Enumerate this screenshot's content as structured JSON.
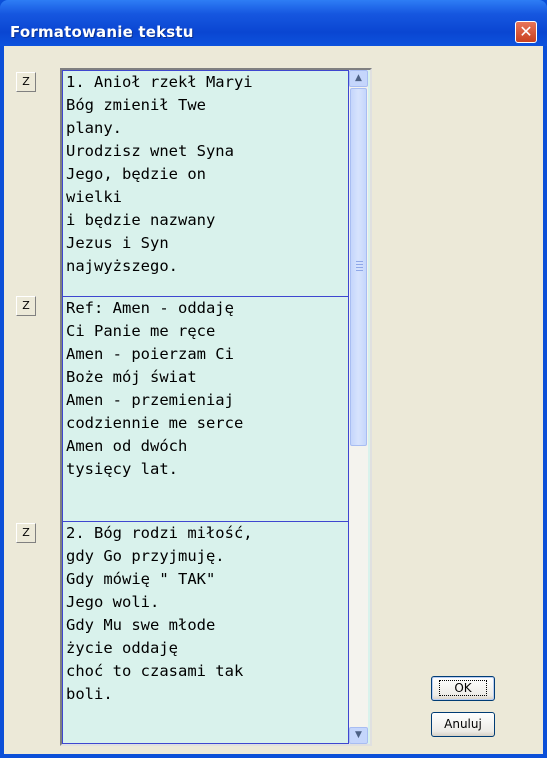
{
  "window": {
    "title": "Formatowanie tekstu",
    "close_glyph": "✕"
  },
  "items": [
    {
      "button_label": "Z",
      "text": "1. Anioł rzekł Maryi\nBóg zmienił Twe\nplany.\nUrodzisz wnet Syna\nJego, będzie on\nwielki\ni będzie nazwany\nJezus i Syn\nnajwyższego."
    },
    {
      "button_label": "Z",
      "text": "Ref: Amen - oddaję\nCi Panie me ręce\nAmen - poierzam Ci\nBoże mój świat\nAmen - przemieniaj\ncodziennie me serce\nAmen od dwóch\ntysięcy lat."
    },
    {
      "button_label": "Z",
      "text": "2. Bóg rodzi miłość,\ngdy Go przyjmuję.\nGdy mówię \" TAK\"\nJego woli.\nGdy Mu swe młode\nżycie oddaję\nchoć to czasami tak\nboli."
    }
  ],
  "buttons": {
    "ok": "OK",
    "cancel": "Anuluj"
  },
  "scrollbar": {
    "up_glyph": "▲",
    "down_glyph": "▼"
  }
}
